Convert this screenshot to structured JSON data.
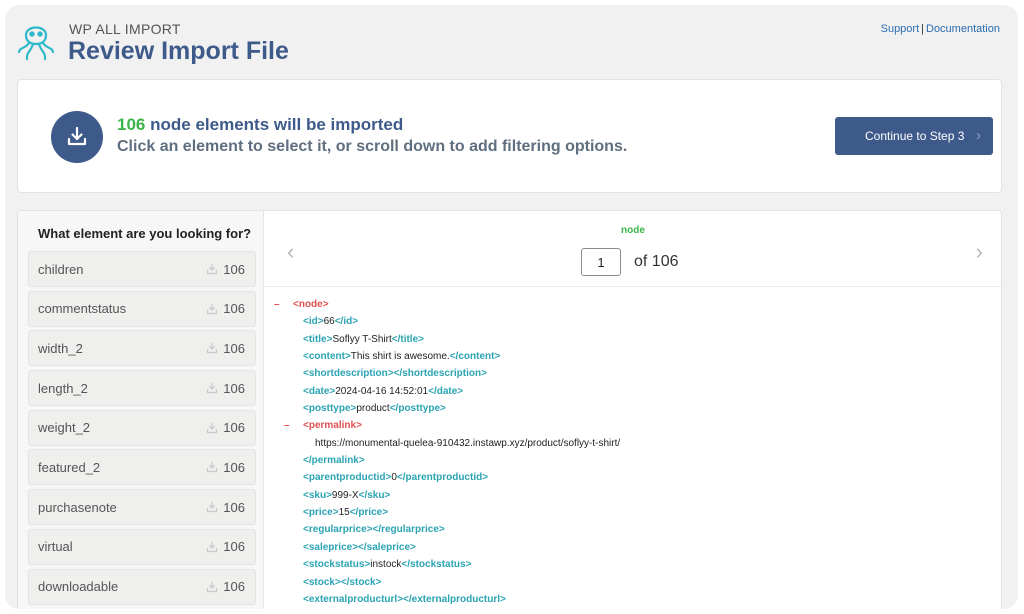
{
  "header": {
    "brand": "WP ALL IMPORT",
    "title": "Review Import File",
    "links": {
      "support": "Support",
      "separator": "|",
      "documentation": "Documentation"
    }
  },
  "summary": {
    "count": "106",
    "line1_rest": "node elements will be imported",
    "line2": "Click an element to select it, or scroll down to add filtering options.",
    "continue_label": "Continue to Step 3",
    "continue_chevron": "›"
  },
  "sidebar": {
    "title": "What element are you looking for?",
    "items": [
      {
        "name": "children",
        "count": "106"
      },
      {
        "name": "commentstatus",
        "count": "106"
      },
      {
        "name": "width_2",
        "count": "106"
      },
      {
        "name": "length_2",
        "count": "106"
      },
      {
        "name": "weight_2",
        "count": "106"
      },
      {
        "name": "featured_2",
        "count": "106"
      },
      {
        "name": "purchasenote",
        "count": "106"
      },
      {
        "name": "virtual",
        "count": "106"
      },
      {
        "name": "downloadable",
        "count": "106"
      }
    ]
  },
  "viewer": {
    "node_label": "node",
    "page_value": "1",
    "of_label": "of 106",
    "prev_icon": "‹",
    "next_icon": "›",
    "xml_lines": [
      {
        "indent": 28,
        "collapse": "–",
        "open": "<node>"
      },
      {
        "indent": 38,
        "open": "<id>",
        "text": "66",
        "close": "</id>"
      },
      {
        "indent": 38,
        "open": "<title>",
        "text": "Soflyy T-Shirt",
        "close": "</title>"
      },
      {
        "indent": 38,
        "open": "<content>",
        "text": "This shirt is awesome.",
        "close": "</content>"
      },
      {
        "indent": 38,
        "open": "<shortdescription>",
        "close": "</shortdescription>"
      },
      {
        "indent": 38,
        "open": "<date>",
        "text": "2024-04-16 14:52:01",
        "close": "</date>"
      },
      {
        "indent": 38,
        "open": "<posttype>",
        "text": "product",
        "close": "</posttype>"
      },
      {
        "indent": 38,
        "collapse": "–",
        "open": "<permalink>"
      },
      {
        "indent": 50,
        "text": "https://monumental-quelea-910432.instawp.xyz/product/soflyy-t-shirt/"
      },
      {
        "indent": 38,
        "close": "</permalink>"
      },
      {
        "indent": 38,
        "open": "<parentproductid>",
        "text": "0",
        "close": "</parentproductid>"
      },
      {
        "indent": 38,
        "open": "<sku>",
        "text": "999-X",
        "close": "</sku>"
      },
      {
        "indent": 38,
        "open": "<price>",
        "text": "15",
        "close": "</price>"
      },
      {
        "indent": 38,
        "open": "<regularprice>",
        "close": "</regularprice>"
      },
      {
        "indent": 38,
        "open": "<saleprice>",
        "close": "</saleprice>"
      },
      {
        "indent": 38,
        "open": "<stockstatus>",
        "text": "instock",
        "close": "</stockstatus>"
      },
      {
        "indent": 38,
        "open": "<stock>",
        "close": "</stock>"
      },
      {
        "indent": 38,
        "open": "<externalproducturl>",
        "close": "</externalproducturl>"
      }
    ]
  },
  "colors": {
    "brand_blue": "#3e5a8a",
    "count_green": "#3bb54a",
    "tag_teal": "#2aa3b3",
    "collapse_red": "#e05050"
  },
  "icons": [
    "octopus-logo-icon",
    "download-icon",
    "chevron-left-icon",
    "chevron-right-icon",
    "minus-collapse-icon"
  ]
}
